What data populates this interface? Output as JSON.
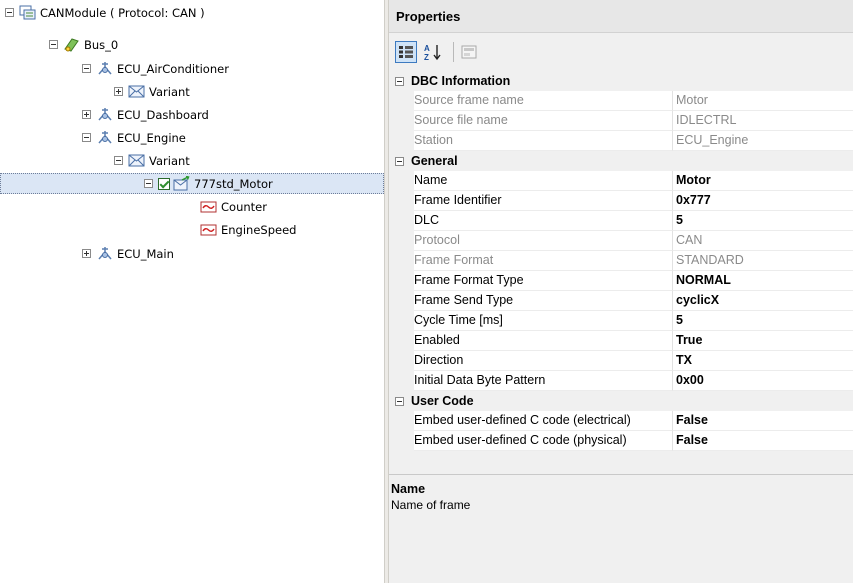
{
  "tree": {
    "root": "CANModule ( Protocol: CAN )",
    "bus": "Bus_0",
    "ecu_airconditioner": "ECU_AirConditioner",
    "variant_ac": "Variant",
    "ecu_dashboard": "ECU_Dashboard",
    "ecu_engine": "ECU_Engine",
    "variant_engine": "Variant",
    "frame": "777std_Motor",
    "signal_counter": "Counter",
    "signal_enginespeed": "EngineSpeed",
    "ecu_main": "ECU_Main"
  },
  "properties": {
    "title": "Properties",
    "categories": {
      "dbc": "DBC Information",
      "general": "General",
      "user_code": "User Code"
    },
    "dbc": [
      {
        "name": "Source frame name",
        "value": "Motor"
      },
      {
        "name": "Source file name",
        "value": "IDLECTRL"
      },
      {
        "name": "Station",
        "value": "ECU_Engine"
      }
    ],
    "general": [
      {
        "name": "Name",
        "value": "Motor"
      },
      {
        "name": "Frame Identifier",
        "value": "0x777"
      },
      {
        "name": "DLC",
        "value": "5"
      },
      {
        "name": "Protocol",
        "value": "CAN"
      },
      {
        "name": "Frame Format",
        "value": "STANDARD"
      },
      {
        "name": "Frame Format Type",
        "value": "NORMAL"
      },
      {
        "name": "Frame Send Type",
        "value": "cyclicX"
      },
      {
        "name": "Cycle Time [ms]",
        "value": "5"
      },
      {
        "name": "Enabled",
        "value": "True"
      },
      {
        "name": "Direction",
        "value": "TX"
      },
      {
        "name": "Initial Data Byte Pattern",
        "value": "0x00"
      }
    ],
    "user_code": [
      {
        "name": "Embed user-defined C code (electrical)",
        "value": "False"
      },
      {
        "name": "Embed user-defined C code (physical)",
        "value": "False"
      }
    ],
    "description": {
      "title": "Name",
      "text": "Name of frame"
    }
  },
  "toolbar": {
    "sort_alpha_label": "A Z"
  }
}
